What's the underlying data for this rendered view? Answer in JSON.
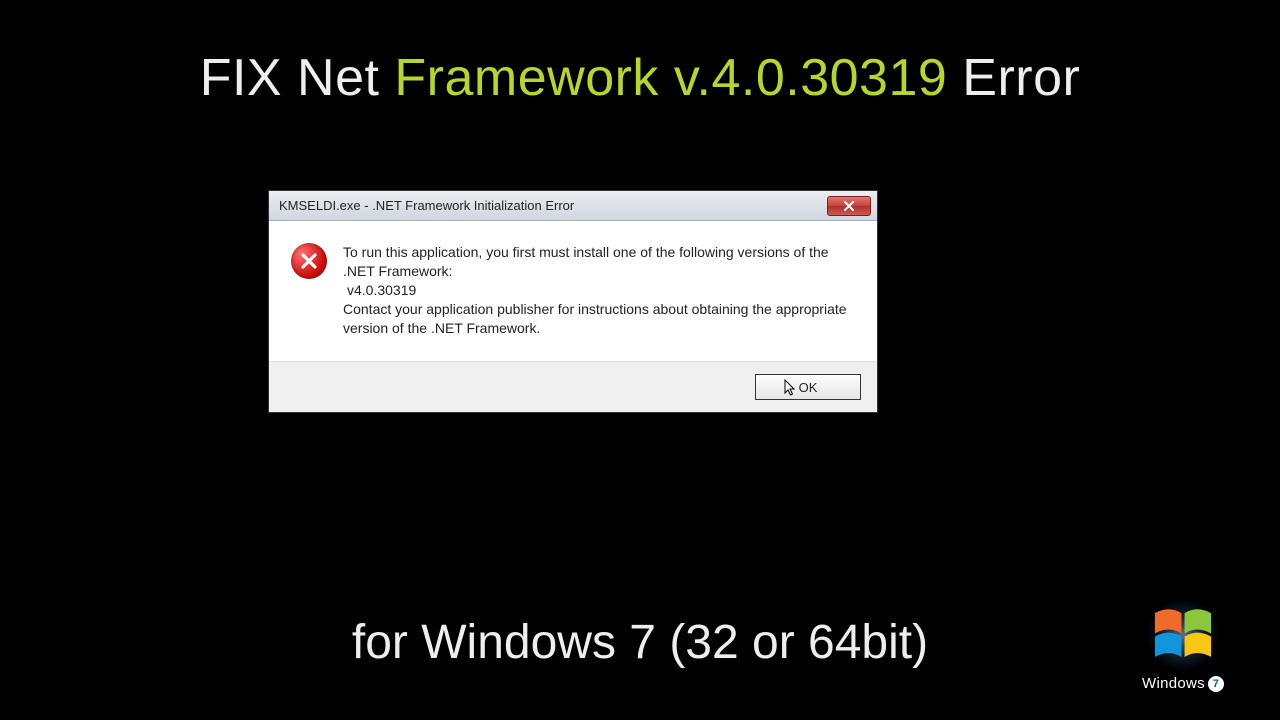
{
  "heading": {
    "part1": "FIX Net ",
    "highlight": "Framework v.4.0.30319",
    "part2": " Error"
  },
  "subheading": "for Windows 7 (32 or 64bit)",
  "dialog": {
    "title": "KMSELDI.exe - .NET Framework Initialization Error",
    "message_line1": "To run this application, you first must install one of the following versions of the .NET Framework:",
    "message_version": "v4.0.30319",
    "message_line2": "Contact your application publisher for instructions about obtaining the appropriate version of the .NET Framework.",
    "ok_label": "OK"
  },
  "logo": {
    "brand": "Windows",
    "version": "7"
  }
}
